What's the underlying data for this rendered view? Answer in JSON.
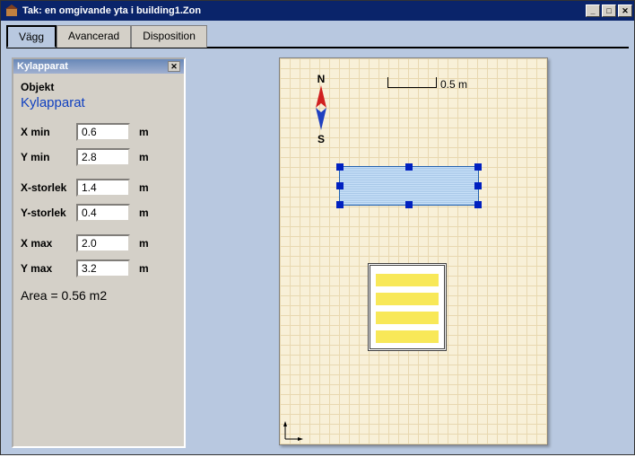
{
  "window": {
    "title": "Tak: en omgivande yta i building1.Zon"
  },
  "tabs": {
    "items": [
      "Vägg",
      "Avancerad",
      "Disposition"
    ],
    "active": 0
  },
  "panel": {
    "title": "Kylapparat",
    "object_label": "Objekt",
    "object_name": "Kylapparat",
    "fields": {
      "xmin": {
        "label": "X min",
        "value": "0.6",
        "unit": "m"
      },
      "ymin": {
        "label": "Y min",
        "value": "2.8",
        "unit": "m"
      },
      "xsize": {
        "label": "X-storlek",
        "value": "1.4",
        "unit": "m"
      },
      "ysize": {
        "label": "Y-storlek",
        "value": "0.4",
        "unit": "m"
      },
      "xmax": {
        "label": "X max",
        "value": "2.0",
        "unit": "m"
      },
      "ymax": {
        "label": "Y max",
        "value": "3.2",
        "unit": "m"
      }
    },
    "area": "Area = 0.56 m2"
  },
  "canvas": {
    "compass": {
      "north": "N",
      "south": "S"
    },
    "scale_label": "0.5 m"
  }
}
